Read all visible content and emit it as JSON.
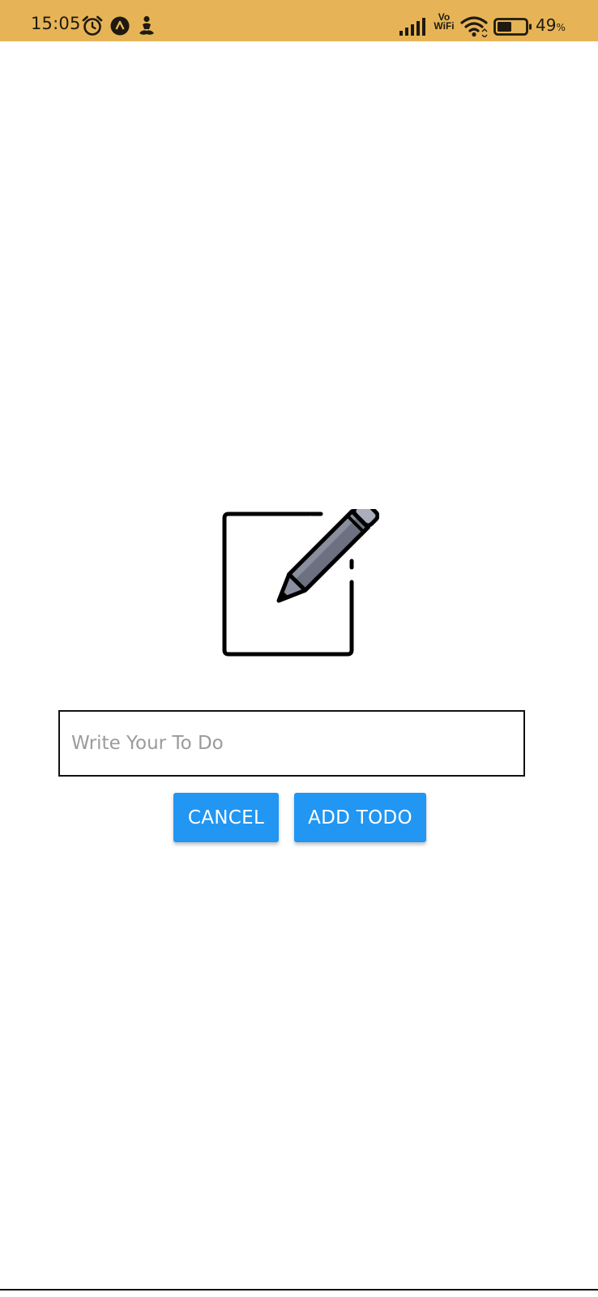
{
  "status_bar": {
    "time": "15:05",
    "left_icons": [
      "alarm-icon",
      "app-notification-icon",
      "meditation-icon"
    ],
    "network": "VoWiFi",
    "vowifi_top": "Vo",
    "vowifi_bottom": "WiFi",
    "battery_percent": "49",
    "battery_percent_sign": "%",
    "background_color": "#e6b457"
  },
  "main": {
    "illustration_icon": "edit-note-icon",
    "todo_input": {
      "value": "",
      "placeholder": "Write Your To Do"
    },
    "buttons": {
      "cancel_label": "CANCEL",
      "add_label": "ADD TODO",
      "color": "#2196f3"
    }
  }
}
